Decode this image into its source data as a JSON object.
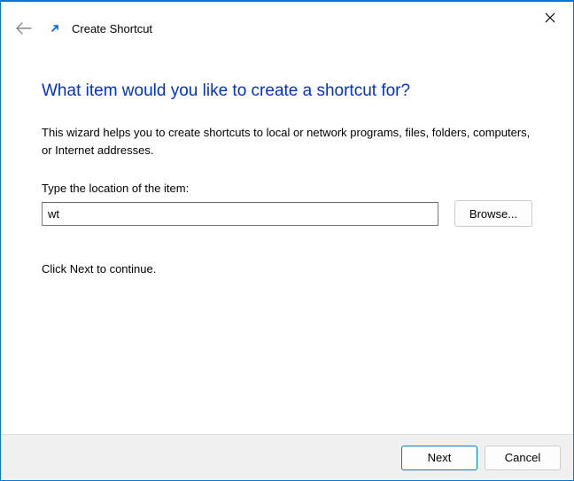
{
  "titlebar": {
    "close_tooltip": "Close"
  },
  "header": {
    "title": "Create Shortcut"
  },
  "content": {
    "heading": "What item would you like to create a shortcut for?",
    "description": "This wizard helps you to create shortcuts to local or network programs, files, folders, computers, or Internet addresses.",
    "location_label": "Type the location of the item:",
    "location_value": "wt",
    "browse_button": "Browse...",
    "continue_text": "Click Next to continue."
  },
  "footer": {
    "next_button": "Next",
    "cancel_button": "Cancel"
  }
}
